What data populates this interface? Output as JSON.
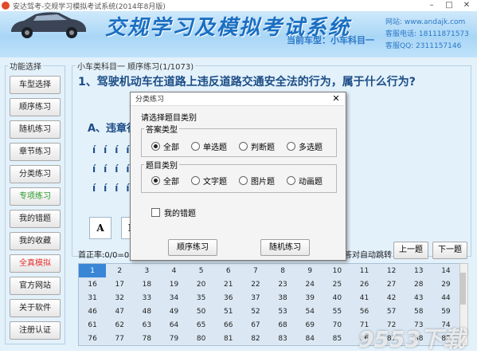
{
  "window": {
    "title": "安达驾考-交规学习模拟考试系统(2014年8月版)",
    "minimize": "–",
    "maximize": "□",
    "close": "✕"
  },
  "banner": {
    "title": "交规学习及模拟考试系统",
    "current_model": "当前车型：小车科目一",
    "website": "网站: www.andajk.com",
    "phone": "客服电话: 18111871573",
    "qq": "客服QQ: 2311157146"
  },
  "sidebar": {
    "group_label": "功能选择",
    "items": [
      {
        "label": "车型选择",
        "color": "#222222"
      },
      {
        "label": "顺序练习",
        "color": "#222222"
      },
      {
        "label": "随机练习",
        "color": "#222222"
      },
      {
        "label": "章节练习",
        "color": "#222222"
      },
      {
        "label": "分类练习",
        "color": "#222222"
      },
      {
        "label": "专项练习",
        "color": "#2a9a2a"
      },
      {
        "label": "我的错题",
        "color": "#222222"
      },
      {
        "label": "我的收藏",
        "color": "#222222"
      },
      {
        "label": "全真模拟",
        "color": "#e03030"
      },
      {
        "label": "官方网站",
        "color": "#222222"
      },
      {
        "label": "关于软件",
        "color": "#222222"
      },
      {
        "label": "注册认证",
        "color": "#222222"
      }
    ]
  },
  "question": {
    "caption": "小车类科目一  顺序练习(1/1073)",
    "text": "1、驾驶机动车在道路上违反道路交通安全法的行为，属于什么行为?",
    "option_a": "A、违章行",
    "answer_buttons": [
      "A",
      "B"
    ],
    "accuracy": "首正率:0/0=0.00",
    "auto_jump": "答对自动跳转",
    "prev": "上一题",
    "next": "下一题"
  },
  "grid": {
    "rows": [
      [
        1,
        2,
        3,
        4,
        5,
        6,
        7,
        8,
        9,
        10,
        11,
        12,
        13,
        14
      ],
      [
        16,
        17,
        18,
        19,
        20,
        21,
        22,
        23,
        24,
        25,
        26,
        27,
        28,
        29
      ],
      [
        31,
        32,
        33,
        34,
        35,
        36,
        37,
        38,
        39,
        40,
        41,
        42,
        43,
        44
      ],
      [
        46,
        47,
        48,
        49,
        50,
        51,
        52,
        53,
        54,
        55,
        56,
        57,
        58,
        59
      ],
      [
        61,
        62,
        63,
        64,
        65,
        66,
        67,
        68,
        69,
        70,
        71,
        72,
        73,
        74
      ],
      [
        76,
        77,
        78,
        79,
        80,
        81,
        82,
        83,
        84,
        85,
        86,
        87,
        88,
        89
      ]
    ]
  },
  "dialog": {
    "title": "分类练习",
    "close": "✕",
    "prompt": "请选择题目类别",
    "answer_type": {
      "label": "答案类型",
      "options": [
        "全部",
        "单选题",
        "判断题",
        "多选题"
      ],
      "selected": 0
    },
    "question_type": {
      "label": "题目类别",
      "options": [
        "全部",
        "文字题",
        "图片题",
        "动画题"
      ],
      "selected": 0
    },
    "wrong_only": "我的错题",
    "buttons": [
      "顺序练习",
      "随机练习"
    ]
  },
  "watermark": "9553下载",
  "colors": {
    "accent": "#1a6fc2",
    "selected_cell": "#3a86d6"
  }
}
